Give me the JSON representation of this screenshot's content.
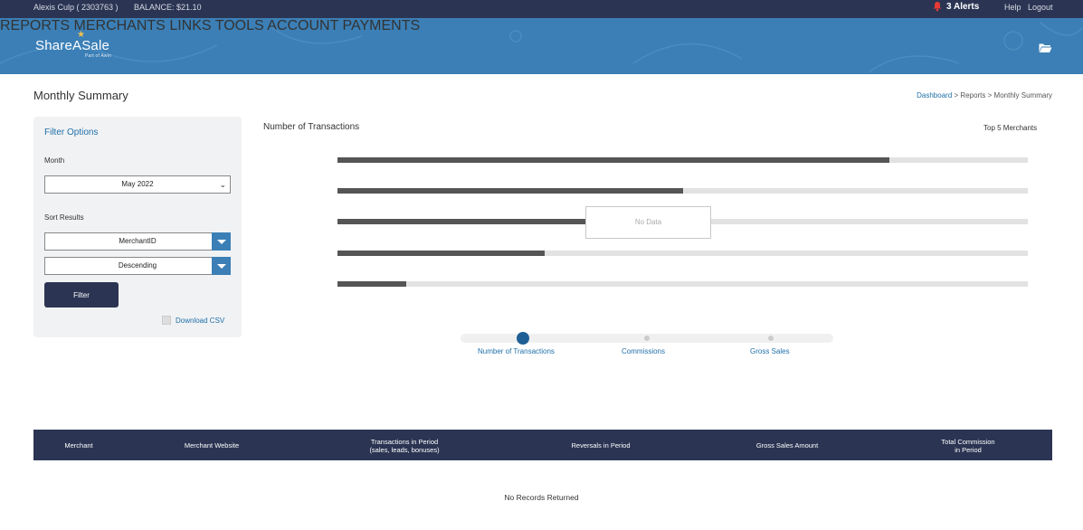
{
  "topbar": {
    "user": "Alexis Culp ( 2303763 )",
    "balance": "BALANCE: $21.10",
    "alerts": "3 Alerts",
    "help": "Help",
    "logout": "Logout"
  },
  "brand": {
    "name": "ShareASale",
    "tagline": "Part of Awin"
  },
  "nav": {
    "items": [
      "REPORTS",
      "MERCHANTS",
      "LINKS",
      "TOOLS",
      "ACCOUNT",
      "PAYMENTS"
    ]
  },
  "page": {
    "title": "Monthly Summary",
    "breadcrumb": {
      "dashboard": "Dashboard",
      "sep1": " > ",
      "reports": "Reports",
      "sep2": " > ",
      "current": "Monthly Summary"
    }
  },
  "filter": {
    "title": "Filter Options",
    "month_label": "Month",
    "month_value": "May 2022",
    "sort_label": "Sort Results",
    "sort_field": "MerchantID",
    "sort_order": "Descending",
    "button": "Filter",
    "download": "Download CSV"
  },
  "chart_data": {
    "type": "bar",
    "title": "Number of Transactions",
    "legend": "Top 5 Merchants",
    "no_data_label": "No Data",
    "bars": [
      0.8,
      0.5,
      0.36,
      0.3,
      0.1
    ]
  },
  "slider": {
    "labels": [
      "Number of Transactions",
      "Commissions",
      "Gross Sales"
    ],
    "active": 0
  },
  "table": {
    "headers": [
      "Merchant",
      "Merchant Website",
      "Transactions in Period\n(sales, leads, bonuses)",
      "Reversals in Period",
      "Gross Sales Amount",
      "Total Commission\nin Period"
    ],
    "empty": "No Records Returned"
  },
  "colors": {
    "topbar": "#2b3553",
    "nav": "#3b7fb6",
    "accent": "#1f6fa8",
    "alert": "#e53935"
  },
  "icons": [
    "bell-icon",
    "folder-icon",
    "chevron-down-icon",
    "dropdown-arrow-icon",
    "star-icon"
  ]
}
